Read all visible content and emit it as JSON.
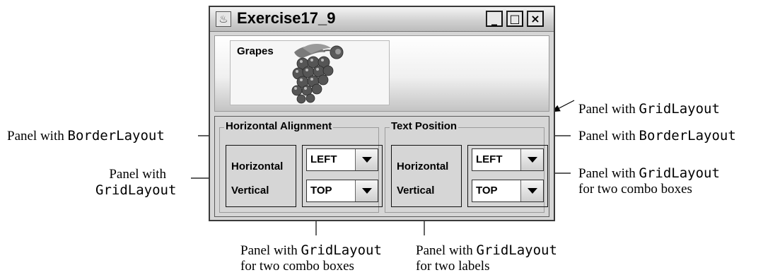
{
  "window": {
    "title": "Exercise17_9",
    "buttons": {
      "minimize": "_",
      "maximize": "□",
      "close": "×"
    }
  },
  "top_panel": {
    "label_text": "Grapes",
    "image_icon": "grapes-image"
  },
  "groups": [
    {
      "title": "Horizontal Alignment",
      "labels": [
        "Horizontal",
        "Vertical"
      ],
      "combos": [
        {
          "value": "LEFT"
        },
        {
          "value": "TOP"
        }
      ]
    },
    {
      "title": "Text Position",
      "labels": [
        "Horizontal",
        "Vertical"
      ],
      "combos": [
        {
          "value": "LEFT"
        },
        {
          "value": "TOP"
        }
      ]
    }
  ],
  "annotations": {
    "left_border": {
      "prefix": "Panel with ",
      "code": "BorderLayout"
    },
    "left_grid": {
      "line1": "Panel with",
      "code": "GridLayout"
    },
    "right_grid_top": {
      "prefix": "Panel with ",
      "code": "GridLayout"
    },
    "right_border": {
      "prefix": "Panel with ",
      "code": "BorderLayout"
    },
    "right_grid_combos": {
      "prefix": "Panel with ",
      "code": "GridLayout",
      "line2": "for two combo boxes"
    },
    "bottom_combos": {
      "prefix": "Panel with ",
      "code": "GridLayout",
      "line2": "for two combo boxes"
    },
    "bottom_labels": {
      "prefix": "Panel with ",
      "code": "GridLayout",
      "line2": "for two labels"
    }
  }
}
